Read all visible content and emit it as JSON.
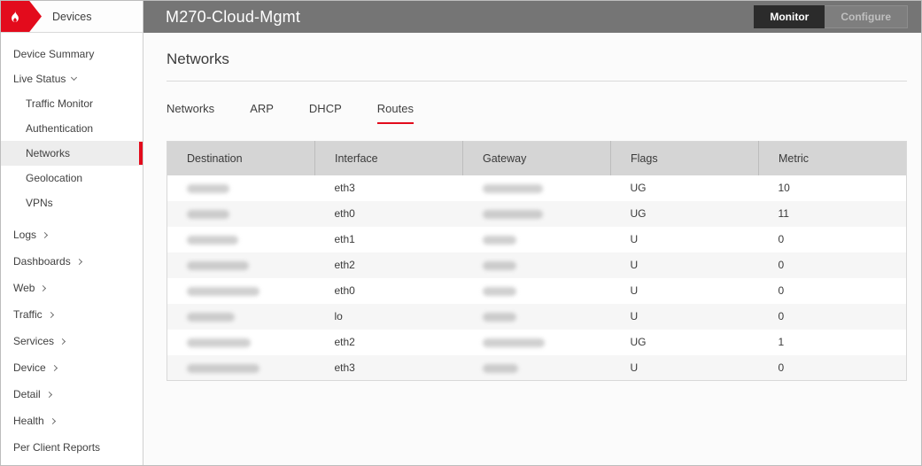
{
  "theme": {
    "accent": "#e30b1c",
    "topbar": "#757575",
    "monitor-btn": "#2b2b2b"
  },
  "sidebar": {
    "header_label": "Devices",
    "items": [
      {
        "label": "Device Summary",
        "sub": false,
        "chevron": null,
        "active": false,
        "group": 1
      },
      {
        "label": "Live Status",
        "sub": false,
        "chevron": "down",
        "active": false,
        "group": 1
      },
      {
        "label": "Traffic Monitor",
        "sub": true,
        "chevron": null,
        "active": false,
        "group": 1
      },
      {
        "label": "Authentication",
        "sub": true,
        "chevron": null,
        "active": false,
        "group": 1
      },
      {
        "label": "Networks",
        "sub": true,
        "chevron": null,
        "active": true,
        "group": 1
      },
      {
        "label": "Geolocation",
        "sub": true,
        "chevron": null,
        "active": false,
        "group": 1
      },
      {
        "label": "VPNs",
        "sub": true,
        "chevron": null,
        "active": false,
        "group": 1
      },
      {
        "label": "Logs",
        "sub": false,
        "chevron": "right",
        "active": false,
        "group": 2
      },
      {
        "label": "Dashboards",
        "sub": false,
        "chevron": "right",
        "active": false,
        "group": 2
      },
      {
        "label": "Web",
        "sub": false,
        "chevron": "right",
        "active": false,
        "group": 2
      },
      {
        "label": "Traffic",
        "sub": false,
        "chevron": "right",
        "active": false,
        "group": 2
      },
      {
        "label": "Services",
        "sub": false,
        "chevron": "right",
        "active": false,
        "group": 2
      },
      {
        "label": "Device",
        "sub": false,
        "chevron": "right",
        "active": false,
        "group": 2
      },
      {
        "label": "Detail",
        "sub": false,
        "chevron": "right",
        "active": false,
        "group": 2
      },
      {
        "label": "Health",
        "sub": false,
        "chevron": "right",
        "active": false,
        "group": 2
      },
      {
        "label": "Per Client Reports",
        "sub": false,
        "chevron": null,
        "active": false,
        "group": 2
      }
    ]
  },
  "topbar": {
    "title": "M270-Cloud-Mgmt",
    "buttons": [
      {
        "label": "Monitor",
        "active": true
      },
      {
        "label": "Configure",
        "active": false
      }
    ]
  },
  "page": {
    "title": "Networks"
  },
  "tabs": [
    {
      "label": "Networks",
      "active": false
    },
    {
      "label": "ARP",
      "active": false
    },
    {
      "label": "DHCP",
      "active": false
    },
    {
      "label": "Routes",
      "active": true
    }
  ],
  "table": {
    "columns": [
      "Destination",
      "Interface",
      "Gateway",
      "Flags",
      "Metric"
    ],
    "rows": [
      {
        "destination": {
          "redacted": true,
          "blob_w": 48
        },
        "interface": "eth3",
        "gateway": {
          "redacted": true,
          "blob_w": 68
        },
        "flags": "UG",
        "metric": "10"
      },
      {
        "destination": {
          "redacted": true,
          "blob_w": 48
        },
        "interface": "eth0",
        "gateway": {
          "redacted": true,
          "blob_w": 68
        },
        "flags": "UG",
        "metric": "11"
      },
      {
        "destination": {
          "redacted": true,
          "blob_w": 58
        },
        "interface": "eth1",
        "gateway": {
          "redacted": true,
          "blob_w": 38
        },
        "flags": "U",
        "metric": "0"
      },
      {
        "destination": {
          "redacted": true,
          "blob_w": 70
        },
        "interface": "eth2",
        "gateway": {
          "redacted": true,
          "blob_w": 38
        },
        "flags": "U",
        "metric": "0"
      },
      {
        "destination": {
          "redacted": true,
          "blob_w": 82
        },
        "interface": "eth0",
        "gateway": {
          "redacted": true,
          "blob_w": 38
        },
        "flags": "U",
        "metric": "0"
      },
      {
        "destination": {
          "redacted": true,
          "blob_w": 54
        },
        "interface": "lo",
        "gateway": {
          "redacted": true,
          "blob_w": 38
        },
        "flags": "U",
        "metric": "0"
      },
      {
        "destination": {
          "redacted": true,
          "blob_w": 72
        },
        "interface": "eth2",
        "gateway": {
          "redacted": true,
          "blob_w": 70
        },
        "flags": "UG",
        "metric": "1"
      },
      {
        "destination": {
          "redacted": true,
          "blob_w": 82
        },
        "interface": "eth3",
        "gateway": {
          "redacted": true,
          "blob_w": 40
        },
        "flags": "U",
        "metric": "0"
      }
    ]
  }
}
